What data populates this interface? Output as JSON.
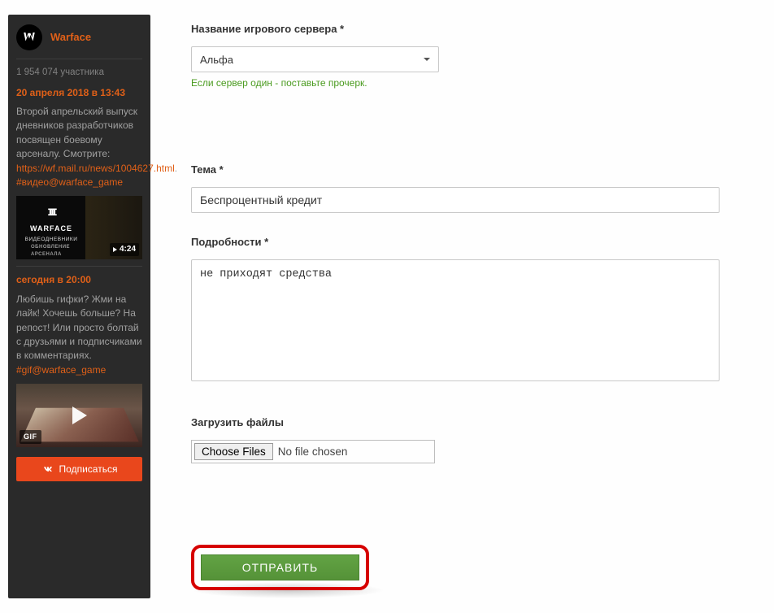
{
  "sidebar": {
    "title": "Warface",
    "subscribers": "1 954 074 участника",
    "post1": {
      "timestamp": "20 апреля 2018 в 13:43",
      "text": "Второй апрельский выпуск дневников разработчиков посвящен боевому арсеналу. Смотрите: ",
      "link": "https://wf.mail.ru/news/1004627.html",
      "dot": ".",
      "hashtag": "#видео@warface_game",
      "thumb_logo": "WARFACE",
      "thumb_sub1": "ВИДЕОДНЕВНИКИ",
      "thumb_sub2": "ОБНОВЛЕНИЕ АРСЕНАЛА",
      "duration": "4:24"
    },
    "post2": {
      "timestamp": "сегодня в 20:00",
      "text": "Любишь гифки? Жми на лайк! Хочешь больше? На репост! Или просто болтай с друзьями и подписчиками в комментариях.",
      "hashtag": "#gif@warface_game",
      "gif_badge": "GIF"
    },
    "subscribe_label": "Подписаться"
  },
  "form": {
    "server_label": "Название игрового сервера *",
    "server_value": "Альфа",
    "server_hint": "Если сервер один - поставьте прочерк.",
    "topic_label": "Тема *",
    "topic_value": "Беспроцентный кредит",
    "details_label": "Подробности *",
    "details_value": "не приходят средства",
    "files_label": "Загрузить файлы",
    "choose_files": "Choose Files",
    "no_file": "No file chosen",
    "submit": "ОТПРАВИТЬ"
  }
}
